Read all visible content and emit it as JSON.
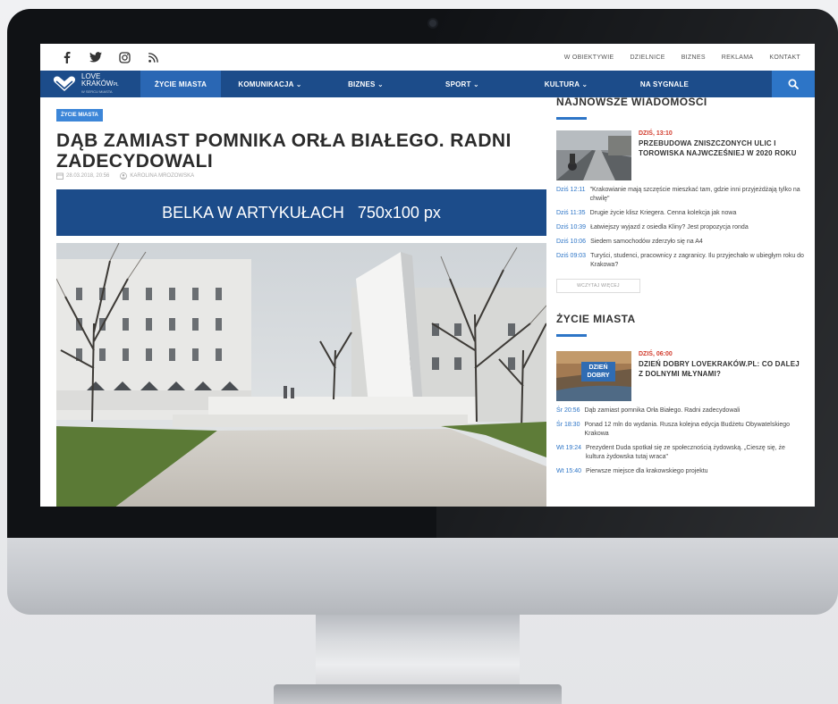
{
  "social_icons": [
    "facebook-icon",
    "twitter-icon",
    "instagram-icon",
    "rss-icon"
  ],
  "toplinks": [
    "W OBIEKTYWIE",
    "DZIELNICE",
    "BIZNES",
    "REKLAMA",
    "KONTAKT"
  ],
  "logo": {
    "line1": "LOVE",
    "line2": "KRAKÓW",
    "suffix": "PL",
    "tagline": "W SERCU MIASTA"
  },
  "nav": [
    {
      "label": "ŻYCIE MIASTA",
      "active": true
    },
    {
      "label": "KOMUNIKACJA ⌄",
      "active": false
    },
    {
      "label": "BIZNES ⌄",
      "active": false
    },
    {
      "label": "SPORT ⌄",
      "active": false
    },
    {
      "label": "KULTURA ⌄",
      "active": false
    },
    {
      "label": "NA SYGNALE",
      "active": false
    }
  ],
  "article": {
    "tag": "ŻYCIE MIASTA",
    "title": "DĄB ZAMIAST POMNIKA ORŁA BIAŁEGO. RADNI ZADECYDOWALI",
    "date": "28.03.2018, 20:56",
    "author": "KAROLINA MROZOWSKA",
    "banner": "BELKA W ARTYKUŁACH   750x100 px"
  },
  "latest": {
    "title": "NAJNOWSZE WIADOMOŚCI",
    "feature": {
      "date": "DZIŚ, 13:10",
      "title": "PRZEBUDOWA ZNISZCZONYCH ULIC I TOROWISKA NAJWCZEŚNIEJ W 2020 ROKU"
    },
    "items": [
      {
        "time": "Dziś 12:11",
        "text": "\"Krakowianie mają szczęście mieszkać tam, gdzie inni przyjeżdżają tylko na chwilę\""
      },
      {
        "time": "Dziś 11:35",
        "text": "Drugie życie klisz Kriegera. Cenna kolekcja jak nowa"
      },
      {
        "time": "Dziś 10:39",
        "text": "Łatwiejszy wyjazd z osiedla Kliny? Jest propozycja ronda"
      },
      {
        "time": "Dziś 10:06",
        "text": "Siedem samochodów zderzyło się na A4"
      },
      {
        "time": "Dziś 09:03",
        "text": "Turyści, studenci, pracownicy z zagranicy. Ilu przyjechało w ubiegłym roku do Krakowa?"
      }
    ],
    "more": "WCZYTAJ WIĘCEJ"
  },
  "city": {
    "title": "ŻYCIE MIASTA",
    "thumb_label": "DZIEŃ DOBRY",
    "feature": {
      "date": "DZIŚ, 06:00",
      "title": "DZIEŃ DOBRY LOVEKRAKÓW.PL: CO DALEJ Z DOLNYMI MŁYNAMI?"
    },
    "items": [
      {
        "time": "Śr 20:56",
        "text": "Dąb zamiast pomnika Orła Białego. Radni zadecydowali"
      },
      {
        "time": "Śr 18:30",
        "text": "Ponad 12 mln do wydania. Rusza kolejna edycja Budżetu Obywatelskiego Krakowa"
      },
      {
        "time": "Wt 19:24",
        "text": "Prezydent Duda spotkał się ze społecznością żydowską. „Cieszę się, że kultura żydowska tutaj wraca\""
      },
      {
        "time": "Wt 15:40",
        "text": "Pierwsze miejsce dla krakowskiego projektu"
      }
    ]
  },
  "colors": {
    "nav": "#1c4c8a",
    "accent": "#2d75c7",
    "tag": "#3c86d8",
    "date_red": "#d23b2c"
  }
}
